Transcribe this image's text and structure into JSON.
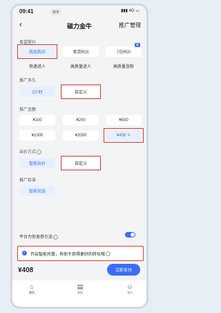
{
  "status": {
    "time": "09:41",
    "app_badge": "快手",
    "signal": "4G"
  },
  "nav": {
    "title": "磁力金牛",
    "action": "推广管理"
  },
  "sections": {
    "goal": {
      "label": "希望提升",
      "options": [
        {
          "label": "商品购买",
          "selected": true
        },
        {
          "label": "卖货ROI"
        },
        {
          "label": "7日ROI",
          "tag": "新"
        },
        {
          "label": "快速进人"
        },
        {
          "label": "高质量进人"
        },
        {
          "label": "高质量涨粉"
        }
      ]
    },
    "duration": {
      "label": "推广多久",
      "options": [
        {
          "label": "2小时",
          "selected": true
        },
        {
          "label": "自定义"
        }
      ]
    },
    "budget": {
      "label": "推广金额",
      "options": [
        {
          "label": "¥100"
        },
        {
          "label": "¥200"
        },
        {
          "label": "¥500"
        },
        {
          "label": "¥1000"
        },
        {
          "label": "¥2000"
        },
        {
          "label": "¥408",
          "selected": true
        }
      ]
    },
    "bid": {
      "label": "出价方式",
      "options": [
        {
          "label": "智能出价",
          "selected": true
        },
        {
          "label": "自定义"
        }
      ]
    },
    "target": {
      "label": "推广给谁",
      "options": [
        {
          "label": "智能优选",
          "selected": true
        }
      ]
    },
    "coupon": {
      "label": "平台为你发券引流",
      "enabled": true
    },
    "smart": {
      "label": "开启智能托管，有助于获得更好的转化哦"
    }
  },
  "footer": {
    "price": "¥408",
    "pay_label": "立即支付"
  },
  "tabs": [
    {
      "label": "首页",
      "icon": "home-icon",
      "active": true
    },
    {
      "label": "数据",
      "icon": "chart-icon"
    },
    {
      "label": "我的",
      "icon": "user-icon"
    }
  ],
  "colors": {
    "accent": "#3b6ef5",
    "highlight": "#e03b2b"
  }
}
